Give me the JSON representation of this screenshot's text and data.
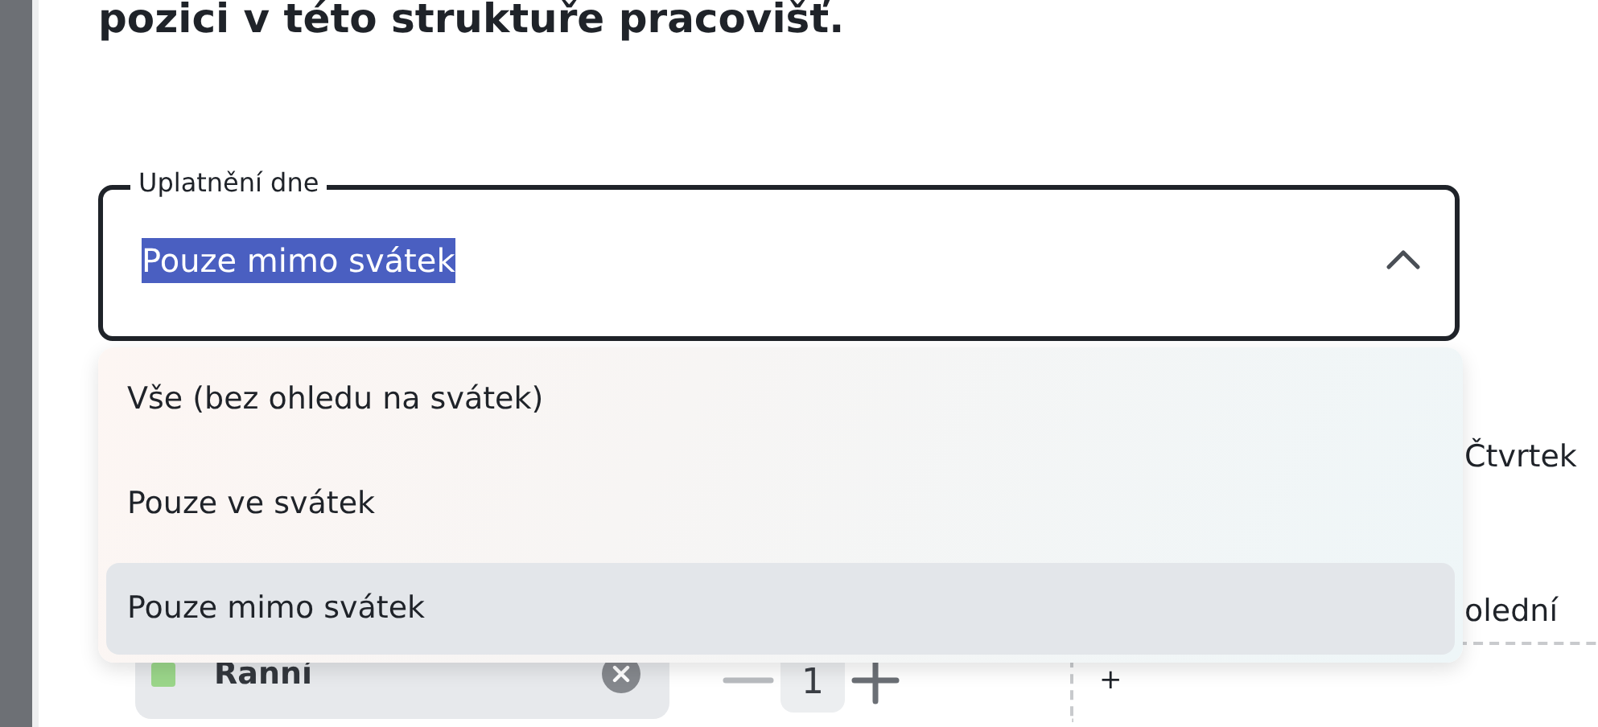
{
  "heading": "pozici v této struktuře pracovišť.",
  "field": {
    "label": "Uplatnění dne",
    "value": "Pouze mimo svátek",
    "expanded": true
  },
  "options": [
    {
      "label": "Vše (bez ohledu na svátek)",
      "selected": false
    },
    {
      "label": "Pouze ve svátek",
      "selected": false
    },
    {
      "label": "Pouze mimo svátek",
      "selected": true
    }
  ],
  "background_labels": [
    "Čtvrtek",
    "olední"
  ],
  "shift": {
    "name": "Ranní",
    "color": "#9bd68a",
    "count": "1"
  },
  "add_button": "+"
}
